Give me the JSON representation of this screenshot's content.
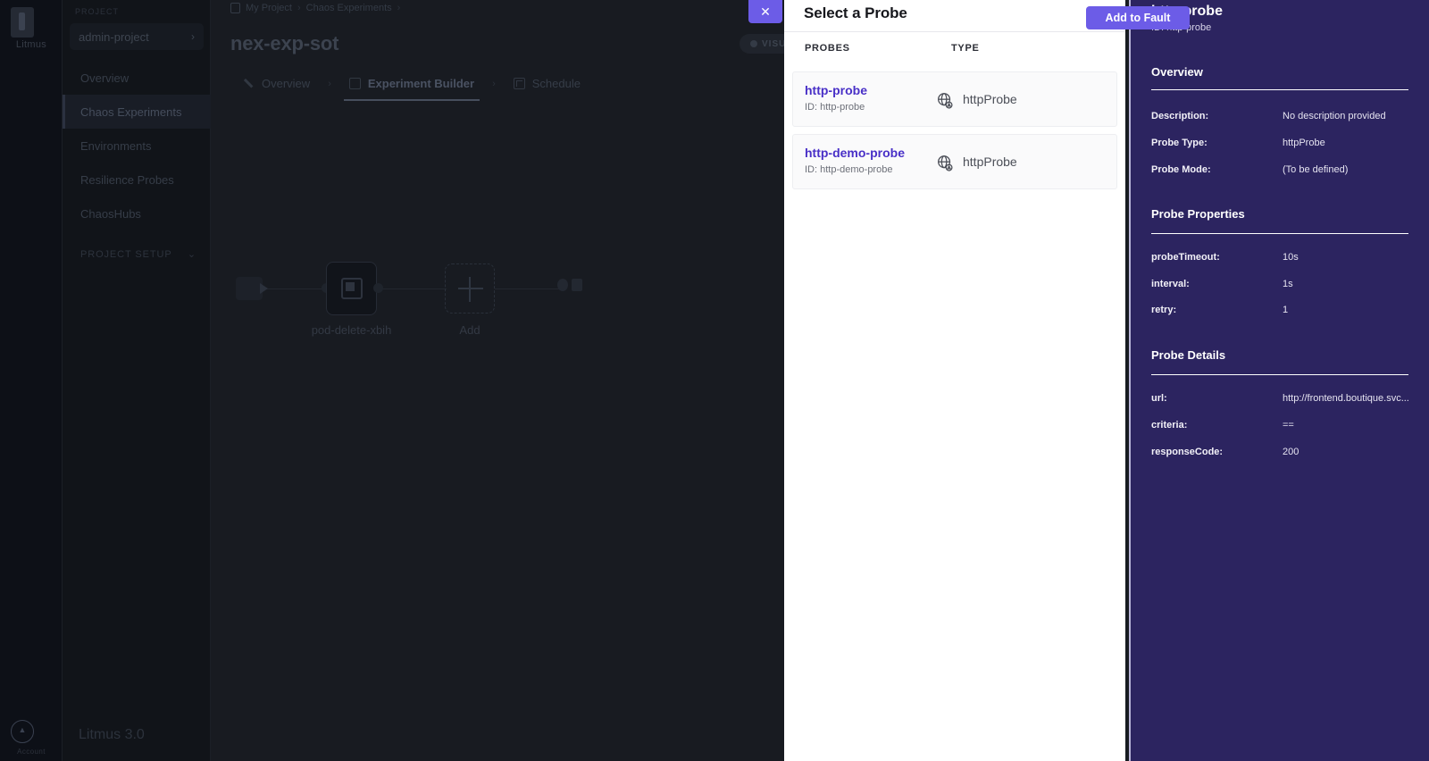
{
  "rail": {
    "logo_name": "litmus-logo",
    "logo_label": "Litmus",
    "account_label": "Account"
  },
  "sidebar": {
    "project_label": "PROJECT",
    "project_name": "admin-project",
    "items": [
      {
        "label": "Overview"
      },
      {
        "label": "Chaos Experiments"
      },
      {
        "label": "Environments"
      },
      {
        "label": "Resilience Probes"
      },
      {
        "label": "ChaosHubs"
      }
    ],
    "section_label": "PROJECT SETUP",
    "footer": "Litmus 3.0"
  },
  "main": {
    "breadcrumb": [
      "My Project",
      "Chaos Experiments"
    ],
    "breadcrumb_separator": "›",
    "page_title": "nex-exp-sot",
    "tabs": [
      {
        "label": "Overview",
        "icon": "pencil-icon",
        "active": false
      },
      {
        "label": "Experiment Builder",
        "icon": "builder-icon",
        "active": true
      },
      {
        "label": "Schedule",
        "icon": "calendar-icon",
        "active": false
      }
    ],
    "tab_separator": "›",
    "visual_badge": "VISUAL",
    "canvas": {
      "fault_node_label": "pod-delete-xbih",
      "add_node_label": "Add"
    }
  },
  "modal": {
    "title": "Select a Probe",
    "close_label": "✕",
    "columns": {
      "probes": "PROBES",
      "type": "TYPE"
    },
    "id_prefix": "ID:",
    "rows": [
      {
        "name": "http-probe",
        "id": "http-probe",
        "type": "httpProbe",
        "icon": "globe-probe-icon"
      },
      {
        "name": "http-demo-probe",
        "id": "http-demo-probe",
        "type": "httpProbe",
        "icon": "globe-probe-icon"
      }
    ]
  },
  "detail": {
    "title": "http-probe",
    "subtitle": "ID: http-probe",
    "add_button": "Add to Fault",
    "sections": [
      {
        "heading": "Overview",
        "rows": [
          {
            "key": "Description:",
            "value": "No description provided"
          },
          {
            "key": "Probe Type:",
            "value": "httpProbe"
          },
          {
            "key": "Probe Mode:",
            "value": "(To be defined)"
          }
        ]
      },
      {
        "heading": "Probe Properties",
        "rows": [
          {
            "key": "probeTimeout:",
            "value": "10s"
          },
          {
            "key": "interval:",
            "value": "1s"
          },
          {
            "key": "retry:",
            "value": "1"
          }
        ]
      },
      {
        "heading": "Probe Details",
        "rows": [
          {
            "key": "url:",
            "value": "http://frontend.boutique.svc..."
          },
          {
            "key": "criteria:",
            "value": "=="
          },
          {
            "key": "responseCode:",
            "value": "200"
          }
        ]
      }
    ]
  },
  "colors": {
    "accent_purple": "#6c5ce7",
    "panel_purple": "#2c2460",
    "probe_link": "#4930c7",
    "app_dark": "#181b21"
  }
}
